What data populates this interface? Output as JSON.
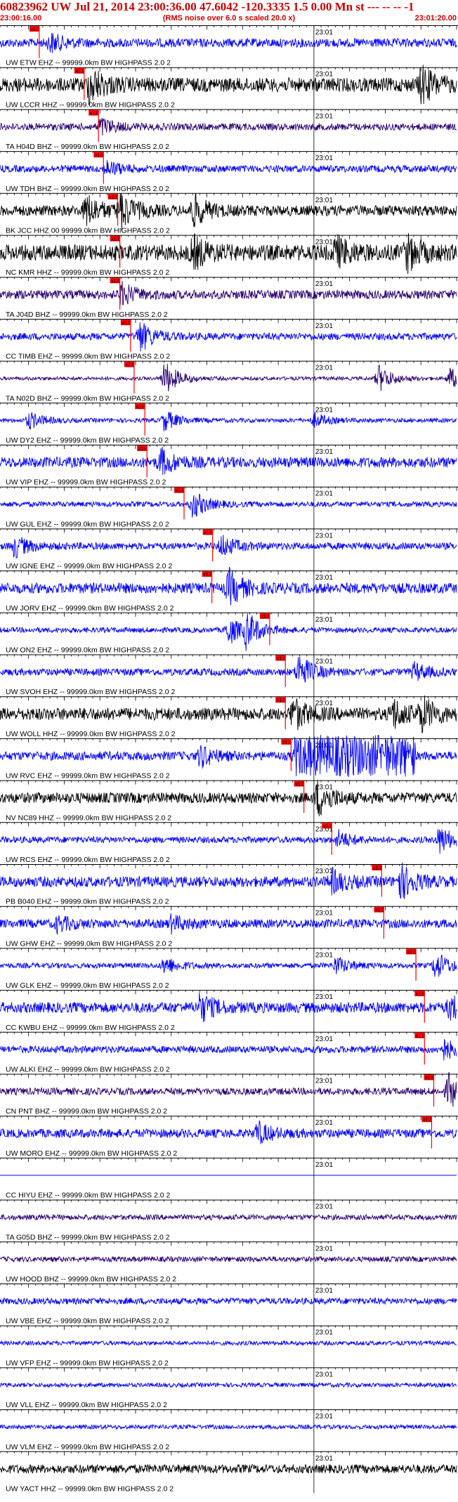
{
  "header": {
    "title": "60823962 UW Jul 21, 2014 23:00:36.00   47.6042 -120.3335  1.5 0.00 Mn st --- -- --  -1",
    "subtitle": "(RMS noise over 6.0 s scaled 20.0 x)",
    "time_start": "23:00:16.00",
    "time_end": "23:01:20.00"
  },
  "colors": {
    "blue": "#0000ff",
    "black": "#000000",
    "purple": "#2a0070",
    "red": "#ff0000",
    "marker_fill": "#ff0000",
    "marker_text": "#000000",
    "axis": "#000000"
  },
  "chart_data": {
    "type": "line",
    "title": "60823962 UW Jul 21, 2014 23:00:36.00   47.6042 -120.3335  1.5 0.00 Mn st --- -- --  -1",
    "subtitle": "(RMS noise over 6.0 s scaled 20.0 x)",
    "x_range_seconds": [
      0,
      64
    ],
    "x_start_label": "23:00:16.00",
    "x_end_label": "23:01:20.00",
    "minute_label": "23:01",
    "minute_tick_s": 44,
    "pick_label": "x1.0",
    "traces": [
      {
        "label": "UW ETW EHZ -- 99999.0km BW  HIGHPASS  2.0  2",
        "color": "blue",
        "pick_s": 5.5,
        "amp": 0.25,
        "events": [
          [
            7,
            0.5
          ]
        ]
      },
      {
        "label": "UW LCCR HHZ -- 99999.0km BW  HIGHPASS  2.0  2",
        "color": "black",
        "pick_s": 11.8,
        "amp": 0.4,
        "events": [
          [
            12.5,
            1.0
          ],
          [
            59,
            1.0
          ]
        ]
      },
      {
        "label": "TA H04D BHZ -- 99999.0km BW  HIGHPASS  2.0  2",
        "color": "purple",
        "pick_s": 13.8,
        "amp": 0.2,
        "events": [
          [
            14,
            0.5
          ]
        ]
      },
      {
        "label": "UW TDH BHZ -- 99999.0km BW  HIGHPASS  2.0  2",
        "color": "blue",
        "pick_s": 14.5,
        "amp": 0.2,
        "events": [
          [
            15,
            0.4
          ]
        ]
      },
      {
        "label": "BK JCC HHZ 00 99999.0km BW  HIGHPASS  2.0  2",
        "color": "black",
        "pick_s": 16.5,
        "amp": 0.3,
        "events": [
          [
            12,
            0.9
          ],
          [
            16.8,
            1.0
          ],
          [
            27,
            0.9
          ]
        ]
      },
      {
        "label": "NC KMR HHZ -- 99999.0km BW  HIGHPASS  2.0  2",
        "color": "black",
        "pick_s": 16.8,
        "amp": 0.45,
        "events": [
          [
            27,
            0.8
          ],
          [
            47,
            0.8
          ],
          [
            57,
            0.9
          ]
        ]
      },
      {
        "label": "TA J04D BHZ -- 99999.0km BW  HIGHPASS  2.0  2",
        "color": "purple",
        "pick_s": 16.8,
        "amp": 0.25,
        "events": [
          [
            17,
            0.6
          ]
        ]
      },
      {
        "label": "CC TIMB EHZ -- 99999.0km BW  HIGHPASS  2.0  2",
        "color": "blue",
        "pick_s": 18.3,
        "amp": 0.2,
        "events": [
          [
            19.5,
            0.9
          ]
        ]
      },
      {
        "label": "TA N02D BHZ -- 99999.0km BW  HIGHPASS  2.0  2",
        "color": "purple",
        "pick_s": 18.8,
        "amp": 0.1,
        "events": [
          [
            23,
            1.0
          ],
          [
            53,
            0.8
          ],
          [
            63,
            0.6
          ]
        ]
      },
      {
        "label": "UW DY2 EHZ -- 99999.0km BW  HIGHPASS  2.0  2",
        "color": "blue",
        "pick_s": 20.3,
        "amp": 0.12,
        "events": [
          [
            4,
            0.5
          ],
          [
            23,
            0.6
          ],
          [
            44,
            0.4
          ]
        ]
      },
      {
        "label": "UW VIP EHZ -- 99999.0km BW  HIGHPASS  2.0  2",
        "color": "blue",
        "pick_s": 20.6,
        "amp": 0.3,
        "events": [
          [
            22.5,
            0.7
          ]
        ]
      },
      {
        "label": "UW GUL EHZ -- 99999.0km BW  HIGHPASS  2.0  2",
        "color": "blue",
        "pick_s": 25.8,
        "amp": 0.15,
        "events": [
          [
            27,
            0.8
          ]
        ]
      },
      {
        "label": "UW IGNE EHZ -- 99999.0km BW  HIGHPASS  2.0  2",
        "color": "blue",
        "pick_s": 29.8,
        "amp": 0.2,
        "events": [
          [
            2,
            0.6
          ],
          [
            31,
            0.6
          ]
        ]
      },
      {
        "label": "UW JORV EHZ -- 99999.0km BW  HIGHPASS  2.0  2",
        "color": "blue",
        "pick_s": 29.7,
        "amp": 0.3,
        "events": [
          [
            32,
            1.0
          ]
        ]
      },
      {
        "label": "UW ON2 EHZ -- 99999.0km BW  HIGHPASS  2.0  2",
        "color": "blue",
        "pick_s": 37.8,
        "amp": 0.15,
        "events": [
          [
            32,
            0.8
          ],
          [
            34.5,
            0.9
          ]
        ]
      },
      {
        "label": "UW SVOH EHZ -- 99999.0km BW  HIGHPASS  2.0  2",
        "color": "blue",
        "pick_s": 40.0,
        "amp": 0.2,
        "events": [
          [
            41.8,
            1.0
          ],
          [
            58,
            0.5
          ]
        ]
      },
      {
        "label": "UW WOLL HHZ -- 99999.0km BW  HIGHPASS  2.0  2",
        "color": "black",
        "pick_s": 40.0,
        "amp": 0.35,
        "events": [
          [
            41,
            0.9
          ],
          [
            55,
            0.8
          ],
          [
            59,
            0.9
          ]
        ]
      },
      {
        "label": "UW RVC EHZ -- 99999.0km BW  HIGHPASS  2.0  2",
        "color": "blue",
        "pick_s": 40.8,
        "amp": 0.25,
        "events": [
          [
            28,
            0.6
          ],
          [
            41.5,
            1.0
          ]
        ],
        "block": [
          41.3,
          58.2
        ]
      },
      {
        "label": "NV NC89 HHZ -- 99999.0km BW  HIGHPASS  2.0  2",
        "color": "black",
        "pick_s": 42.6,
        "amp": 0.3,
        "events": [
          [
            44.5,
            1.0
          ]
        ]
      },
      {
        "label": "UW RCS EHZ -- 99999.0km BW  HIGHPASS  2.0  2",
        "color": "blue",
        "pick_s": 46.5,
        "amp": 0.18,
        "events": [
          [
            47.3,
            0.5
          ],
          [
            61.5,
            0.8
          ]
        ]
      },
      {
        "label": "PB B040 EHZ -- 99999.0km BW  HIGHPASS  2.0  2",
        "color": "blue",
        "pick_s": 53.5,
        "amp": 0.3,
        "events": [
          [
            46.5,
            0.6
          ],
          [
            56,
            1.0
          ]
        ]
      },
      {
        "label": "UW GHW EHZ -- 99999.0km BW  HIGHPASS  2.0  2",
        "color": "blue",
        "pick_s": 53.8,
        "amp": 0.25,
        "events": [
          [
            8,
            0.4
          ],
          [
            24,
            0.4
          ]
        ]
      },
      {
        "label": "UW GLK EHZ -- 99999.0km BW  HIGHPASS  2.0  2",
        "color": "blue",
        "pick_s": 58.3,
        "amp": 0.15,
        "events": [
          [
            23,
            0.5
          ],
          [
            47,
            0.5
          ],
          [
            61,
            0.8
          ]
        ]
      },
      {
        "label": "CC KWBU EHZ -- 99999.0km BW  HIGHPASS  2.0  2",
        "color": "blue",
        "pick_s": 59.5,
        "amp": 0.3,
        "events": [
          [
            28,
            0.8
          ],
          [
            63,
            0.7
          ]
        ]
      },
      {
        "label": "UW ALKI EHZ -- 99999.0km BW  HIGHPASS  2.0  2",
        "color": "blue",
        "pick_s": 59.5,
        "amp": 0.2,
        "events": [
          [
            62,
            0.6
          ]
        ]
      },
      {
        "label": "CN PNT BHZ -- 99999.0km BW  HIGHPASS  2.0  2",
        "color": "purple",
        "pick_s": 60.8,
        "amp": 0.2,
        "events": [
          [
            62.8,
            1.0
          ]
        ]
      },
      {
        "label": "UW MORO EHZ -- 99999.0km BW  HIGHPASS  2.0  2",
        "color": "blue",
        "pick_s": 60.5,
        "amp": 0.25,
        "events": [
          [
            36,
            0.6
          ]
        ]
      },
      {
        "label": "CC HIYU EHZ -- 99999.0km BW  HIGHPASS  2.0  2",
        "color": "blue",
        "pick_s": null,
        "amp": 0.0,
        "events": []
      },
      {
        "label": "TA G05D BHZ -- 99999.0km BW  HIGHPASS  2.0  2",
        "color": "purple",
        "pick_s": null,
        "amp": 0.15,
        "events": []
      },
      {
        "label": "UW HOOD BHZ -- 99999.0km BW  HIGHPASS  2.0  2",
        "color": "purple",
        "pick_s": null,
        "amp": 0.15,
        "events": []
      },
      {
        "label": "UW VBE EHZ -- 99999.0km BW  HIGHPASS  2.0  2",
        "color": "blue",
        "pick_s": null,
        "amp": 0.18,
        "events": []
      },
      {
        "label": "UW VFP EHZ -- 99999.0km BW  HIGHPASS  2.0  2",
        "color": "blue",
        "pick_s": null,
        "amp": 0.12,
        "events": []
      },
      {
        "label": "UW VLL EHZ -- 99999.0km BW  HIGHPASS  2.0  2",
        "color": "blue",
        "pick_s": null,
        "amp": 0.12,
        "events": []
      },
      {
        "label": "UW VLM EHZ -- 99999.0km BW  HIGHPASS  2.0  2",
        "color": "blue",
        "pick_s": null,
        "amp": 0.12,
        "events": []
      },
      {
        "label": "UW YACT HHZ -- 99999.0km BW  HIGHPASS  2.0  2",
        "color": "black",
        "pick_s": null,
        "amp": 0.25,
        "events": []
      }
    ]
  }
}
